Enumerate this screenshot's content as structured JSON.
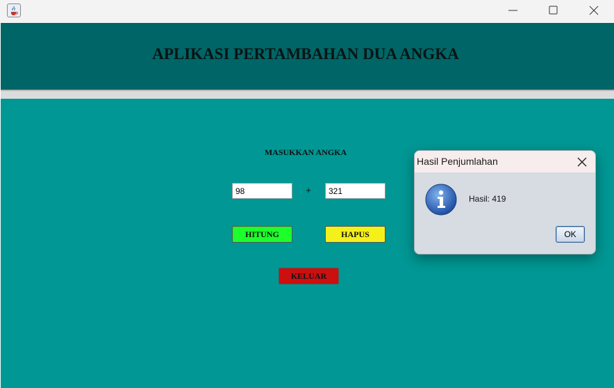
{
  "window": {
    "app_icon": "java-coffee-icon",
    "controls": [
      "minimize-icon",
      "maximize-icon",
      "close-icon"
    ]
  },
  "header": {
    "title": "APLIKASI PERTAMBAHAN DUA ANGKA"
  },
  "form": {
    "label": "MASUKKAN ANGKA",
    "input1_value": "98",
    "operator": "+",
    "input2_value": "321",
    "hitung_label": "HITUNG",
    "hapus_label": "HAPUS",
    "keluar_label": "KELUAR"
  },
  "dialog": {
    "title": "Hasil Penjumlahan",
    "message": "Hasil: 419",
    "ok_label": "OK",
    "icon": "info-icon"
  },
  "colors": {
    "header_bg": "#006566",
    "body_bg": "#009794",
    "hitung_bg": "#1dff2b",
    "hapus_bg": "#f4f01a",
    "keluar_bg": "#cc0f0f"
  }
}
